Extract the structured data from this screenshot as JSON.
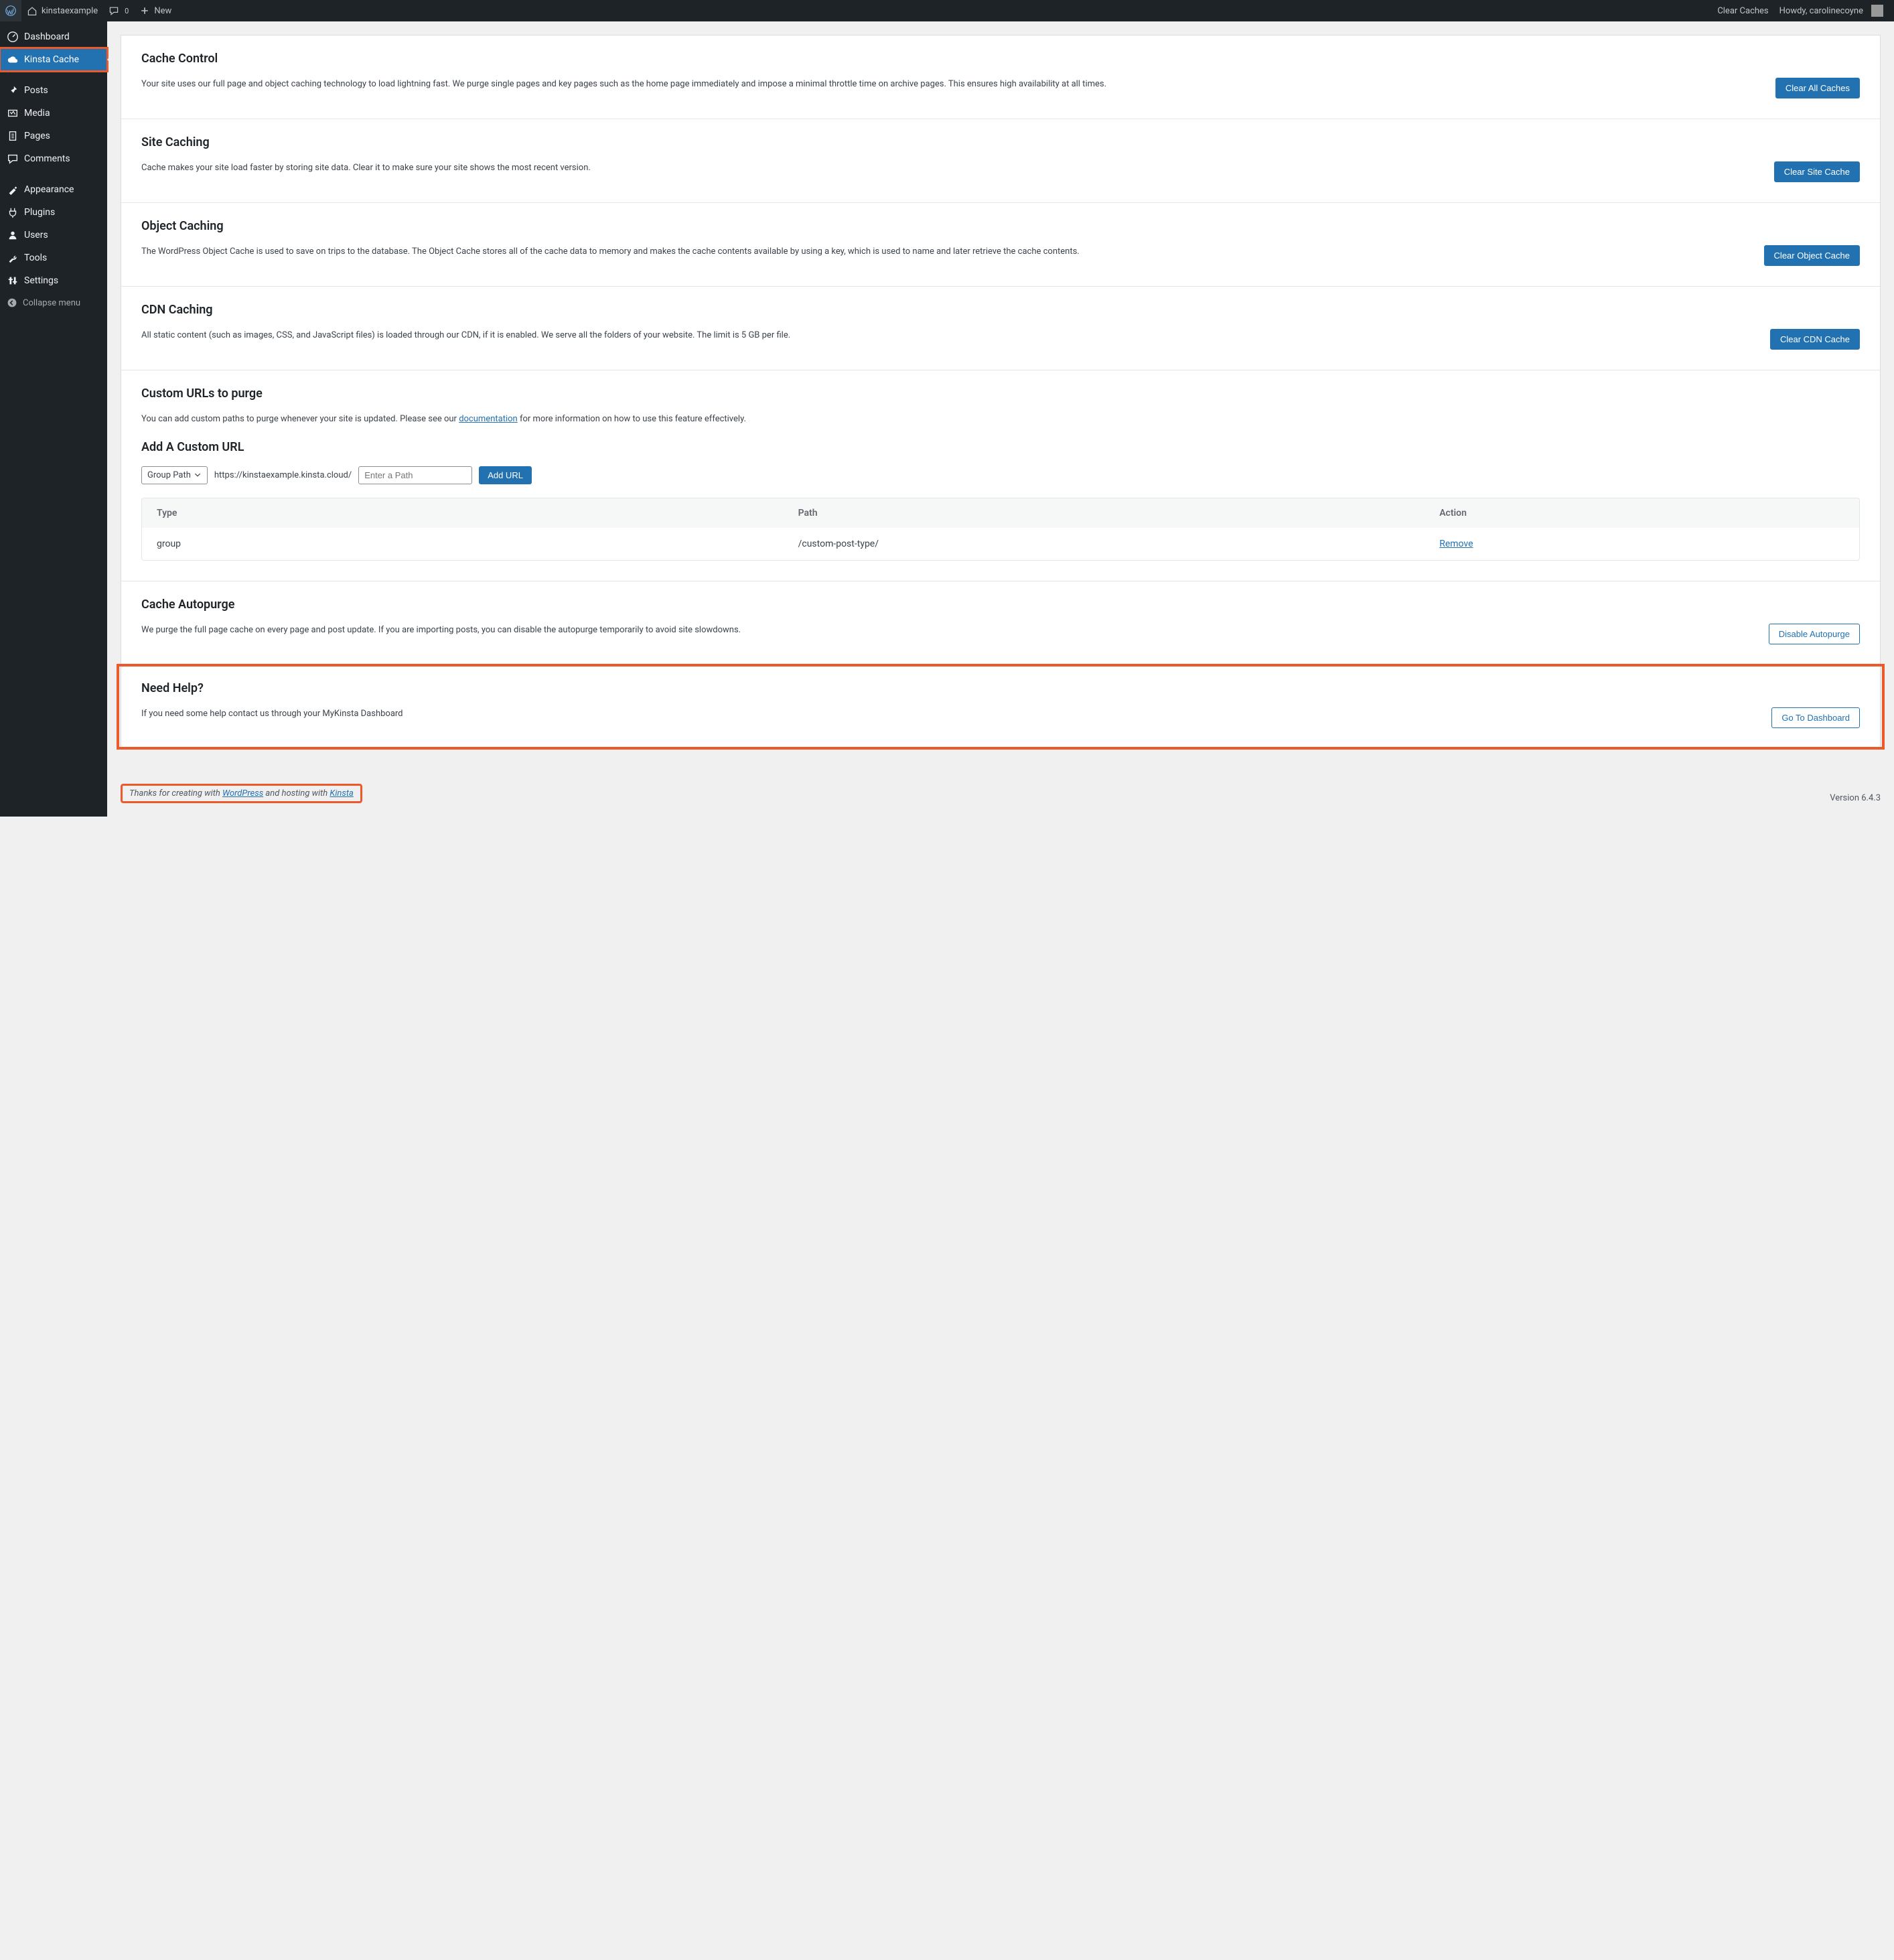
{
  "adminbar": {
    "site_name": "kinstaexample",
    "comment_count": "0",
    "new_label": "New",
    "clear_caches": "Clear Caches",
    "howdy": "Howdy, carolinecoyne"
  },
  "sidemenu": {
    "items": [
      {
        "label": "Dashboard",
        "icon": "dashboard"
      },
      {
        "label": "Kinsta Cache",
        "icon": "cloud",
        "current": true,
        "outlined": true
      },
      {
        "label": "Posts",
        "icon": "pin"
      },
      {
        "label": "Media",
        "icon": "media"
      },
      {
        "label": "Pages",
        "icon": "pages"
      },
      {
        "label": "Comments",
        "icon": "comment"
      },
      {
        "label": "Appearance",
        "icon": "appearance"
      },
      {
        "label": "Plugins",
        "icon": "plugin"
      },
      {
        "label": "Users",
        "icon": "users"
      },
      {
        "label": "Tools",
        "icon": "tools"
      },
      {
        "label": "Settings",
        "icon": "settings"
      }
    ],
    "collapse": "Collapse menu"
  },
  "sections": {
    "cache_control": {
      "title": "Cache Control",
      "desc": "Your site uses our full page and object caching technology to load lightning fast. We purge single pages and key pages such as the home page immediately and impose a minimal throttle time on archive pages. This ensures high availability at all times.",
      "button": "Clear All Caches"
    },
    "site_caching": {
      "title": "Site Caching",
      "desc": "Cache makes your site load faster by storing site data. Clear it to make sure your site shows the most recent version.",
      "button": "Clear Site Cache"
    },
    "object_caching": {
      "title": "Object Caching",
      "desc": "The WordPress Object Cache is used to save on trips to the database. The Object Cache stores all of the cache data to memory and makes the cache contents available by using a key, which is used to name and later retrieve the cache contents.",
      "button": "Clear Object Cache"
    },
    "cdn_caching": {
      "title": "CDN Caching",
      "desc": "All static content (such as images, CSS, and JavaScript files) is loaded through our CDN, if it is enabled. We serve all the folders of your website. The limit is 5 GB per file.",
      "button": "Clear CDN Cache"
    },
    "custom_urls": {
      "title": "Custom URLs to purge",
      "desc_pre": "You can add custom paths to purge whenever your site is updated. Please see our ",
      "doc_link": "documentation",
      "desc_post": " for more information on how to use this feature effectively.",
      "add_title": "Add A Custom URL",
      "select_value": "Group Path",
      "url_prefix": "https://kinstaexample.kinsta.cloud/",
      "input_placeholder": "Enter a Path",
      "add_btn": "Add URL",
      "table": {
        "headers": {
          "type": "Type",
          "path": "Path",
          "action": "Action"
        },
        "rows": [
          {
            "type": "group",
            "path": "/custom-post-type/",
            "action": "Remove"
          }
        ]
      }
    },
    "autopurge": {
      "title": "Cache Autopurge",
      "desc": "We purge the full page cache on every page and post update. If you are importing posts, you can disable the autopurge temporarily to avoid site slowdowns.",
      "button": "Disable Autopurge"
    },
    "help": {
      "title": "Need Help?",
      "desc": "If you need some help contact us through your MyKinsta Dashboard",
      "button": "Go To Dashboard"
    }
  },
  "footer": {
    "thanks_pre": "Thanks for creating with ",
    "wp_link": "WordPress",
    "thanks_mid": " and hosting with ",
    "kinsta_link": "Kinsta",
    "version": "Version 6.4.3"
  }
}
